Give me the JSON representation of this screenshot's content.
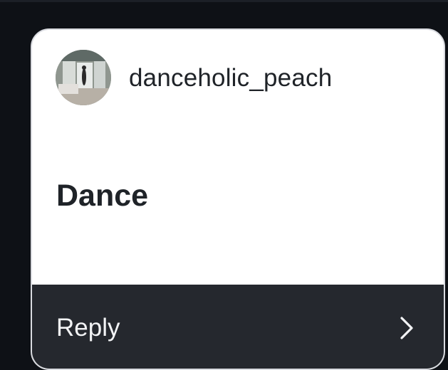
{
  "post": {
    "username": "danceholic_peach",
    "message": "Dance",
    "avatar_icon": "profile-photo"
  },
  "reply": {
    "label": "Reply",
    "icon": "chevron-right-icon"
  },
  "colors": {
    "background": "#0e1116",
    "card": "#ffffff",
    "card_border": "#d9dbe0",
    "reply_bar": "#25282e",
    "text_dark": "#1f2328",
    "text_light": "#f2f3f5"
  }
}
